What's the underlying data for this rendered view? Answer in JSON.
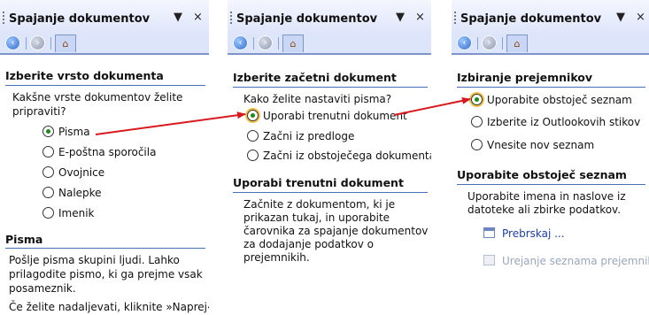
{
  "pane1": {
    "title": "Spajanje dokumentov",
    "heading1": "Izberite vrsto dokumenta",
    "question": [
      "Kakšne vrste dokumentov želite",
      "pripraviti?"
    ],
    "options": [
      "Pisma",
      "E-poštna sporočila",
      "Ovojnice",
      "Nalepke",
      "Imenik"
    ],
    "selected": 0,
    "heading2": "Pisma",
    "desc": [
      "Pošlje pisma skupini ljudi. Lahko",
      "prilagodite pismo, ki ga prejme vsak",
      "posameznik."
    ],
    "footer": "Če želite nadaljevati, kliknite »Naprej«."
  },
  "pane2": {
    "title": "Spajanje dokumentov",
    "heading1": "Izberite začetni dokument",
    "question": "Kako želite nastaviti pisma?",
    "options": [
      "Uporabi trenutni dokument",
      "Začni iz predloge",
      "Začni iz obstoječega dokumenta"
    ],
    "selected": 0,
    "heading2": "Uporabi trenutni dokument",
    "desc": [
      "Začnite z dokumentom, ki je",
      "prikazan tukaj, in uporabite",
      "čarovnika za spajanje dokumentov",
      "za dodajanje podatkov o",
      "prejemnikih."
    ]
  },
  "pane3": {
    "title": "Spajanje dokumentov",
    "heading1": "Izbiranje prejemnikov",
    "options": [
      "Uporabite obstoječ seznam",
      "Izberite iz Outlookovih stikov",
      "Vnesite nov seznam"
    ],
    "selected": 0,
    "heading2": "Uporabite obstoječ seznam",
    "desc": [
      "Uporabite imena in naslove iz",
      "datoteke ali zbirke podatkov."
    ],
    "link_browse": "Prebrskaj ...",
    "link_edit": "Urejanje seznama prejemnikov"
  },
  "controls": {
    "dropdown": "▼",
    "close": "×",
    "back": "‹",
    "forward": "›",
    "home": "⌂"
  },
  "colors": {
    "arrow": "#d8191f",
    "selected_radio": "#1a8a1a",
    "link": "#1f3fa8",
    "header": "#dfe6fb"
  },
  "icons": {
    "arrow": "arrow-icon",
    "back": "back-arrow-icon",
    "forward": "forward-arrow-icon",
    "home": "home-icon",
    "browse": "browse-icon",
    "edit": "edit-list-icon"
  }
}
